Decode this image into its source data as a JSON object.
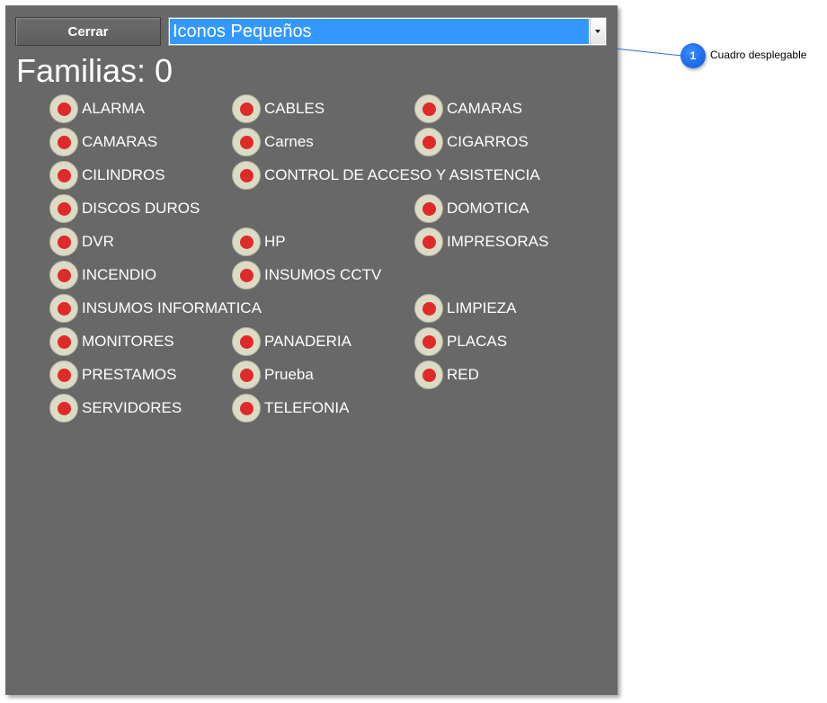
{
  "toolbar": {
    "close_label": "Cerrar",
    "view_select": {
      "selected": "Iconos Pequeños"
    }
  },
  "header": {
    "families_label": "Familias: 0"
  },
  "colors": {
    "panel_bg": "#686868",
    "select_highlight": "#3399ff",
    "radio_dot": "#e02a2a",
    "radio_ring": "#dcdcc6",
    "callout_blue": "#0a56d8"
  },
  "families": [
    {
      "label": "ALARMA",
      "col": 0,
      "row": 0
    },
    {
      "label": "CABLES",
      "col": 1,
      "row": 0
    },
    {
      "label": "CAMARAS",
      "col": 2,
      "row": 0
    },
    {
      "label": "CAMARAS",
      "col": 0,
      "row": 1
    },
    {
      "label": "Carnes",
      "col": 1,
      "row": 1
    },
    {
      "label": "CIGARROS",
      "col": 2,
      "row": 1
    },
    {
      "label": "CILINDROS",
      "col": 0,
      "row": 2
    },
    {
      "label": "CONTROL DE ACCESO Y ASISTENCIA",
      "col": 1,
      "row": 2
    },
    {
      "label": "DISCOS DUROS",
      "col": 0,
      "row": 3
    },
    {
      "label": "DOMOTICA",
      "col": 2,
      "row": 3
    },
    {
      "label": "DVR",
      "col": 0,
      "row": 4
    },
    {
      "label": "HP",
      "col": 1,
      "row": 4
    },
    {
      "label": "IMPRESORAS",
      "col": 2,
      "row": 4
    },
    {
      "label": "INCENDIO",
      "col": 0,
      "row": 5
    },
    {
      "label": "INSUMOS CCTV",
      "col": 1,
      "row": 5
    },
    {
      "label": "INSUMOS INFORMATICA",
      "col": 0,
      "row": 6
    },
    {
      "label": "LIMPIEZA",
      "col": 2,
      "row": 6
    },
    {
      "label": "MONITORES",
      "col": 0,
      "row": 7
    },
    {
      "label": "PANADERIA",
      "col": 1,
      "row": 7
    },
    {
      "label": "PLACAS",
      "col": 2,
      "row": 7
    },
    {
      "label": "PRESTAMOS",
      "col": 0,
      "row": 8
    },
    {
      "label": "Prueba",
      "col": 1,
      "row": 8
    },
    {
      "label": "RED",
      "col": 2,
      "row": 8
    },
    {
      "label": "SERVIDORES",
      "col": 0,
      "row": 9
    },
    {
      "label": "TELEFONIA",
      "col": 1,
      "row": 9
    }
  ],
  "callout": {
    "number": "1",
    "text": "Cuadro desplegable"
  }
}
